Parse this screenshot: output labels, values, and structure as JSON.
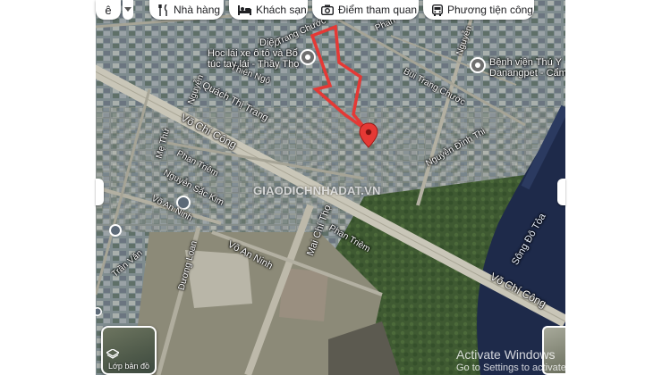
{
  "toolbar": {
    "back_glyph": "ê",
    "chips": [
      {
        "label": "Nhà hàng",
        "icon": "fork-knife-icon"
      },
      {
        "label": "Khách sạn",
        "icon": "bed-icon"
      },
      {
        "label": "Điểm tham quan",
        "icon": "camera-icon"
      },
      {
        "label": "Phương tiện công c",
        "icon": "bus-icon"
      }
    ]
  },
  "map": {
    "roads": [
      "Diệp",
      "Trang Chước",
      "Quách Thị Trang",
      "Nguyễn",
      "Võ Chí Công",
      "Mẹ Thứ",
      "Phan Triêm",
      "Nguyễn Sắc Kim",
      "Võ An Ninh",
      "Mai Chí Thọ",
      "Phan Triêm",
      "Võ An Ninh",
      "Trần Văn",
      "Dương Loan",
      "Võ Chí Công",
      "Bùi Trang Chước",
      "Nguyễn Đình Thi",
      "Nguyễn",
      "Phan",
      "Thiện Ngộ"
    ],
    "river_label": "Sông Đô Tỏa",
    "pois": [
      {
        "name": "Học lái xe ô tô và Bổ túc tay lái - Thầy Thọ",
        "line1": "Học lái xe ô tô và Bổ",
        "line2": "túc tay lái - Thầy Thọ",
        "icon": "place-marker-icon"
      },
      {
        "name": "Bệnh viện Thú Y Danangpet - Cẩm",
        "line1": "Bệnh viện Thú Y",
        "line2": "Danangpet - Cẩm",
        "icon": "place-marker-icon"
      }
    ],
    "watermark": "GIAODICHNHADAT.VN",
    "layers_label": "Lớp bản đồ",
    "os_notice": {
      "title": "Activate Windows",
      "subtitle": "Go to Settings to activate Windows."
    },
    "colors": {
      "arrow": "#e53935",
      "pin": "#e53935",
      "water": "#1e2a4a",
      "road": "#c9c6b8"
    }
  }
}
